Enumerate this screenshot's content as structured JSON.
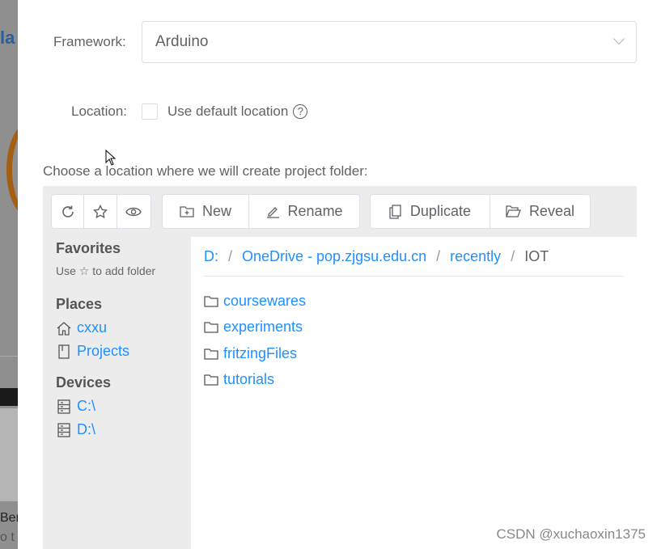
{
  "form": {
    "framework_label": "Framework:",
    "framework_value": "Arduino",
    "location_label": "Location:",
    "use_default_label": "Use default location",
    "help_glyph": "?",
    "choose_text": "Choose a location where we will create project folder:"
  },
  "toolbar": {
    "new": "New",
    "rename": "Rename",
    "duplicate": "Duplicate",
    "reveal": "Reveal"
  },
  "sidebar": {
    "favorites": "Favorites",
    "favorites_hint_pre": "Use",
    "favorites_hint_post": "to add folder",
    "places": "Places",
    "place_items": [
      "cxxu",
      "Projects"
    ],
    "devices": "Devices",
    "device_items": [
      "C:\\",
      "D:\\"
    ]
  },
  "breadcrumb": [
    "D:",
    "OneDrive - pop.zjgsu.edu.cn",
    "recently",
    "IOT"
  ],
  "folders": [
    "coursewares",
    "experiments",
    "fritzingFiles",
    "tutorials"
  ],
  "background": {
    "title_fragment": "la",
    "text1": "Ber",
    "text2": "o t"
  },
  "watermark": "CSDN @xuchaoxin1375",
  "colors": {
    "link": "#1e90ff",
    "panel": "#ececec"
  }
}
